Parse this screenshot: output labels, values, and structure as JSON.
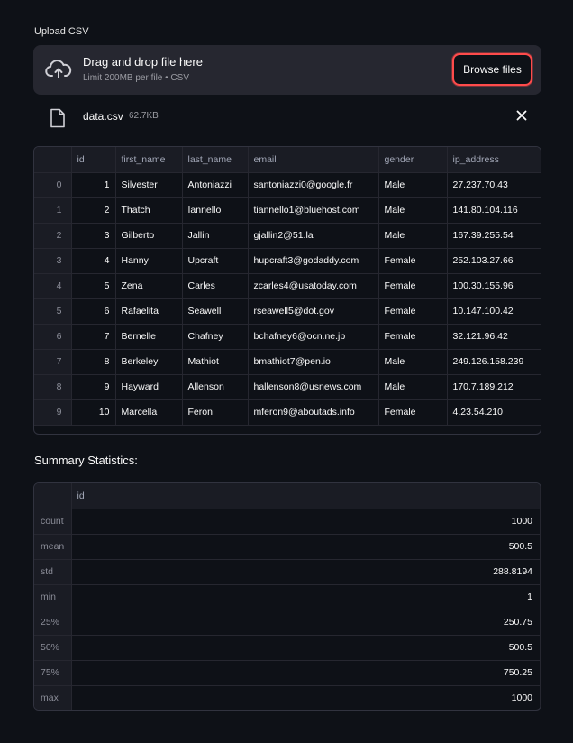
{
  "uploader": {
    "label": "Upload CSV",
    "title": "Drag and drop file here",
    "subtitle": "Limit 200MB per file • CSV",
    "browse_label": "Browse files",
    "accent": "#ff4b4b"
  },
  "file": {
    "name": "data.csv",
    "size": "62.7KB"
  },
  "data_table": {
    "columns": [
      "",
      "id",
      "first_name",
      "last_name",
      "email",
      "gender",
      "ip_address"
    ],
    "rows": [
      [
        "0",
        "1",
        "Silvester",
        "Antoniazzi",
        "santoniazzi0@google.fr",
        "Male",
        "27.237.70.43"
      ],
      [
        "1",
        "2",
        "Thatch",
        "Iannello",
        "tiannello1@bluehost.com",
        "Male",
        "141.80.104.116"
      ],
      [
        "2",
        "3",
        "Gilberto",
        "Jallin",
        "gjallin2@51.la",
        "Male",
        "167.39.255.54"
      ],
      [
        "3",
        "4",
        "Hanny",
        "Upcraft",
        "hupcraft3@godaddy.com",
        "Female",
        "252.103.27.66"
      ],
      [
        "4",
        "5",
        "Zena",
        "Carles",
        "zcarles4@usatoday.com",
        "Female",
        "100.30.155.96"
      ],
      [
        "5",
        "6",
        "Rafaelita",
        "Seawell",
        "rseawell5@dot.gov",
        "Female",
        "10.147.100.42"
      ],
      [
        "6",
        "7",
        "Bernelle",
        "Chafney",
        "bchafney6@ocn.ne.jp",
        "Female",
        "32.121.96.42"
      ],
      [
        "7",
        "8",
        "Berkeley",
        "Mathiot",
        "bmathiot7@pen.io",
        "Male",
        "249.126.158.239"
      ],
      [
        "8",
        "9",
        "Hayward",
        "Allenson",
        "hallenson8@usnews.com",
        "Male",
        "170.7.189.212"
      ],
      [
        "9",
        "10",
        "Marcella",
        "Feron",
        "mferon9@aboutads.info",
        "Female",
        "4.23.54.210"
      ]
    ]
  },
  "summary": {
    "title": "Summary Statistics:",
    "column": "id",
    "rows": [
      [
        "count",
        "1000"
      ],
      [
        "mean",
        "500.5"
      ],
      [
        "std",
        "288.8194"
      ],
      [
        "min",
        "1"
      ],
      [
        "25%",
        "250.75"
      ],
      [
        "50%",
        "500.5"
      ],
      [
        "75%",
        "750.25"
      ],
      [
        "max",
        "1000"
      ]
    ]
  },
  "icons": [
    "cloud-upload-icon",
    "file-icon",
    "close-icon"
  ]
}
